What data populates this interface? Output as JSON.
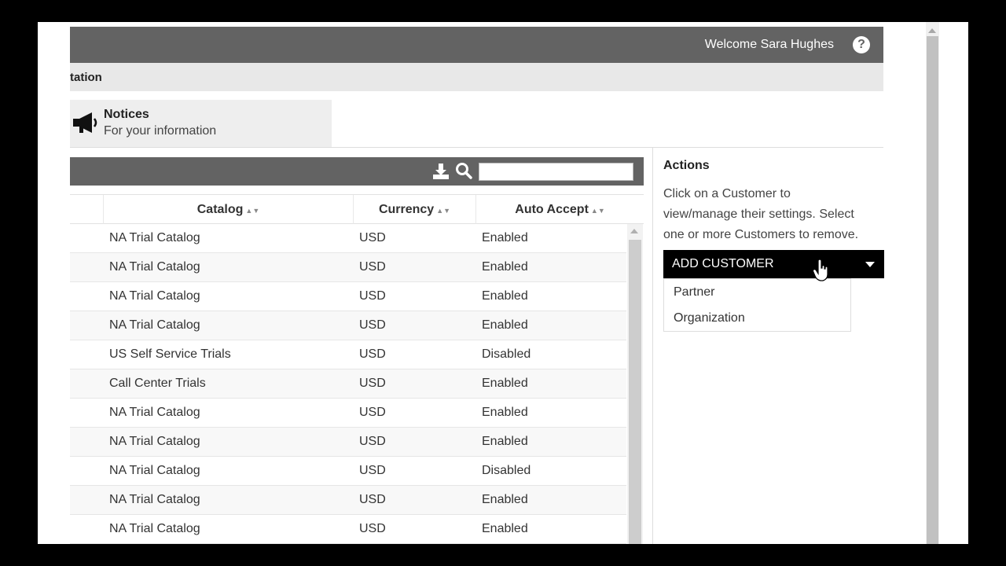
{
  "header": {
    "welcome": "Welcome Sara Hughes",
    "help_symbol": "?"
  },
  "subbar": {
    "title": "tation"
  },
  "notices": {
    "title": "Notices",
    "subtitle": "For your information",
    "icon": "megaphone-icon"
  },
  "table": {
    "search_value": "",
    "columns": [
      {
        "label": "Catalog",
        "sortable": true
      },
      {
        "label": "Currency",
        "sortable": true
      },
      {
        "label": "Auto Accept",
        "sortable": true
      }
    ],
    "rows": [
      {
        "catalog": "NA Trial Catalog",
        "currency": "USD",
        "auto_accept": "Enabled"
      },
      {
        "catalog": "NA Trial Catalog",
        "currency": "USD",
        "auto_accept": "Enabled"
      },
      {
        "catalog": "NA Trial Catalog",
        "currency": "USD",
        "auto_accept": "Enabled"
      },
      {
        "catalog": "NA Trial Catalog",
        "currency": "USD",
        "auto_accept": "Enabled"
      },
      {
        "catalog": "US Self Service Trials",
        "currency": "USD",
        "auto_accept": "Disabled"
      },
      {
        "catalog": "Call Center Trials",
        "currency": "USD",
        "auto_accept": "Enabled"
      },
      {
        "catalog": "NA Trial Catalog",
        "currency": "USD",
        "auto_accept": "Enabled"
      },
      {
        "catalog": "NA Trial Catalog",
        "currency": "USD",
        "auto_accept": "Enabled"
      },
      {
        "catalog": "NA Trial Catalog",
        "currency": "USD",
        "auto_accept": "Disabled"
      },
      {
        "catalog": "NA Trial Catalog",
        "currency": "USD",
        "auto_accept": "Enabled"
      },
      {
        "catalog": "NA Trial Catalog",
        "currency": "USD",
        "auto_accept": "Enabled"
      }
    ]
  },
  "actions": {
    "title": "Actions",
    "description": "Click on a Customer to view/manage their settings. Select one or more Customers to remove.",
    "add_customer_label": "ADD CUSTOMER",
    "dropdown_items": [
      "Partner",
      "Organization"
    ]
  }
}
